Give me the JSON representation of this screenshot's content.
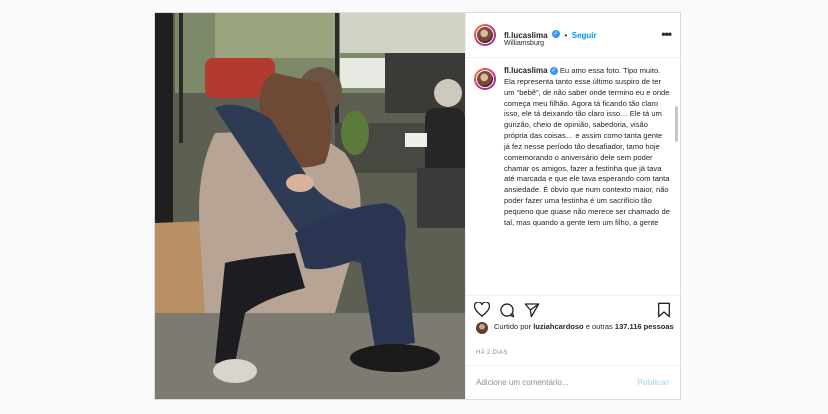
{
  "post": {
    "username": "fl.lucaslima",
    "follow_label": "Seguir",
    "separator": "•",
    "location": "Williamsburg",
    "caption": "Eu amo essa foto. Tipo muito. Ela representa tanto esse último suspiro de ter um “bebê”, de não saber onde termino eu e onde começa meu filhão. Agora tá ficando tão claro isso, ele tá deixando tão claro isso… Ele tá um gurizão, cheio de opinião, sabedoria, visão própria das coisas… e assim como tanta gente já fez nesse período tão desafiador, tamo hoje comemorando o aniversário dele sem poder chamar os amigos, fazer a festinha que já tava até marcada e que ele tava esperando com tanta ansiedade. É óbvio que num contexto maior, não poder fazer uma festinha é um sacrifício tão pequeno que quase não merece ser chamado de tal, mas quando a gente tem um filho, a gente",
    "likes_prefix": "Curtido por ",
    "likes_user": "luziahcardoso",
    "likes_suffix": " e outras ",
    "likes_count": "137.116 pessoas",
    "time_ago": "HÁ 2 DIAS",
    "comment_placeholder": "Adicione um comentário...",
    "publish_label": "Publicar"
  },
  "icons": {
    "verified": "verified-badge-icon",
    "more": "more-options-icon",
    "like": "heart-icon",
    "comment": "comment-icon",
    "share": "share-icon",
    "save": "bookmark-icon"
  },
  "colors": {
    "link_blue": "#0095f6",
    "verified_blue": "#3897f0",
    "muted": "#8e8e8e",
    "border": "#dbdbdb"
  }
}
